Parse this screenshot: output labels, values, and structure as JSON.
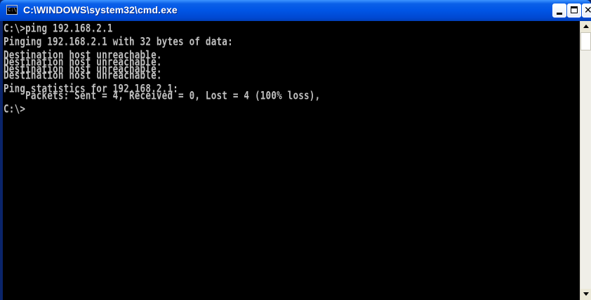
{
  "window": {
    "title": "C:\\WINDOWS\\system32\\cmd.exe",
    "icon": "cmd-icon",
    "icon_text": "C:\\",
    "buttons": {
      "minimize": "minimize-icon",
      "maximize": "maximize-icon",
      "close": "close-icon"
    }
  },
  "colors": {
    "titlebar": "#0055e5",
    "console_bg": "#000000",
    "console_text": "#c0c0c0"
  },
  "console": {
    "lines": [
      "C:\\>ping 192.168.2.1",
      "",
      "Pinging 192.168.2.1 with 32 bytes of data:",
      "",
      "Destination host unreachable.",
      "Destination host unreachable.",
      "Destination host unreachable.",
      "Destination host unreachable.",
      "",
      "Ping statistics for 192.168.2.1:",
      "    Packets: Sent = 4, Received = 0, Lost = 4 (100% loss),",
      "",
      "C:\\>"
    ]
  }
}
